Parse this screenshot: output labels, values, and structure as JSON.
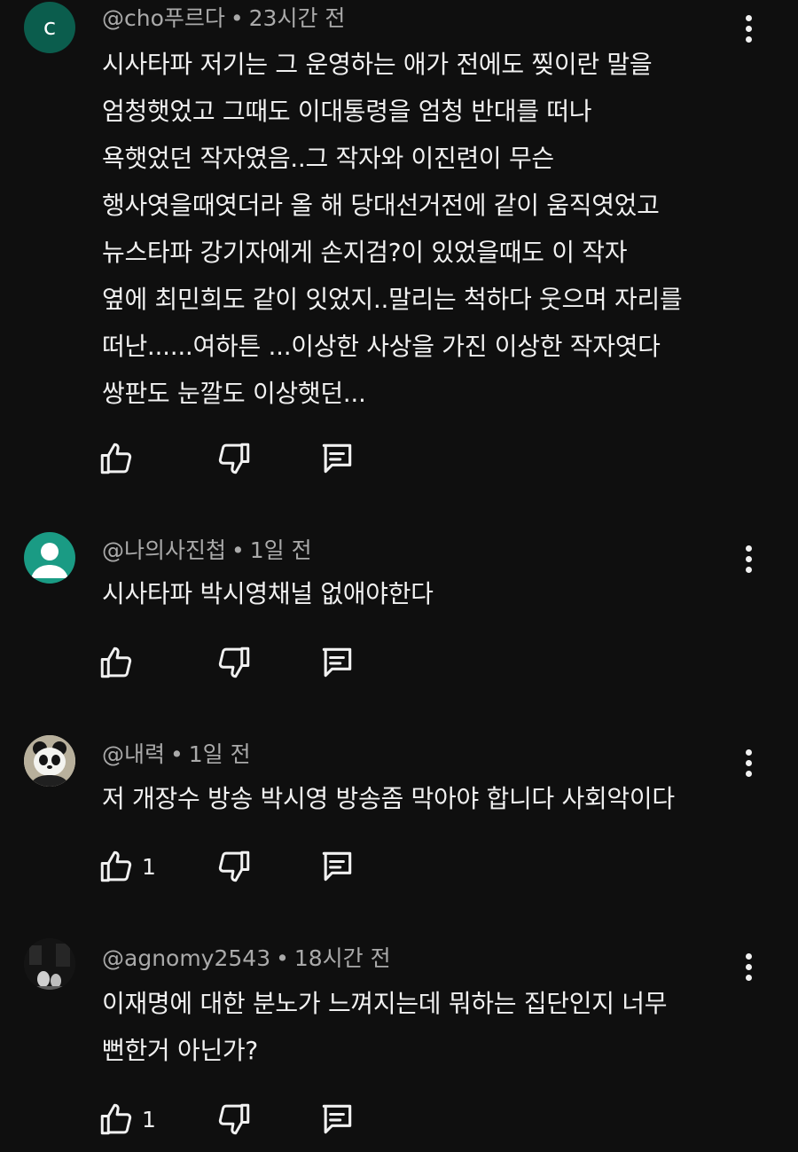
{
  "comments": [
    {
      "avatar_letter": "c",
      "avatar_color": "#0b5d4d",
      "handle": "@cho푸르다",
      "time": "23시간 전",
      "text": "시사타파 저기는  그 운영하는 애가  전에도 찢이란 말을\n엄청햇었고 그때도 이대통령을 엄청 반대를 떠나\n욕햇었던 작자였음..그 작자와 이진련이  무슨\n행사엿을때엿더라 올 해 당대선거전에 같이 움직엿었고\n뉴스타파 강기자에게  손지검?이 있었을때도   이 작자\n옆에 최민희도 같이 잇었지..말리는 척하다 웃으며 자리를\n떠난......여하튼 ...이상한 사상을 가진 이상한 작자엿다\n쌍판도 눈깔도 이상햇던...",
      "like_count": ""
    },
    {
      "avatar_color": "#1a9b84",
      "handle": "@나의사진첩",
      "time": "1일 전",
      "text": "시사타파 박시영채널 없애야한다",
      "like_count": ""
    },
    {
      "handle": "@내력",
      "time": "1일 전",
      "text": "저 개장수 방송 박시영 방송좀 막아야 합니다 사회악이다",
      "like_count": "1"
    },
    {
      "handle": "@agnomy2543",
      "time": "18시간 전",
      "text": "이재명에 대한 분노가 느껴지는데 뭐하는 집단인지 너무\n뻔한거 아닌가?",
      "like_count": "1"
    }
  ],
  "header_separator": "•",
  "icons": {
    "like": "thumbs-up-icon",
    "dislike": "thumbs-down-icon",
    "reply": "reply-comment-icon",
    "menu": "more-vertical-icon"
  }
}
